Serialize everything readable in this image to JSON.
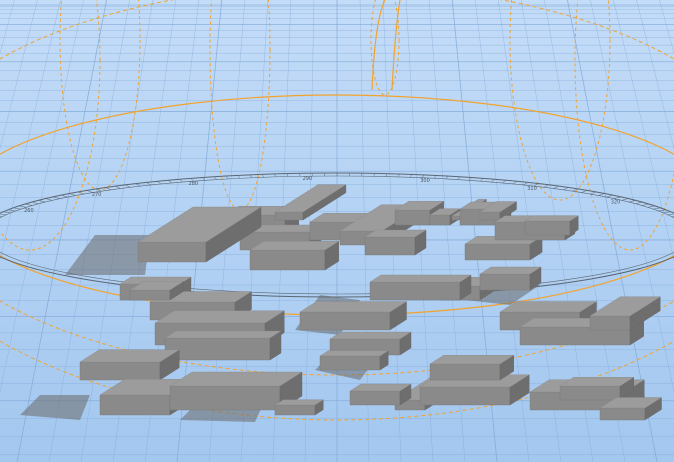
{
  "view": {
    "mode": "3d-city-massing",
    "colors": {
      "sky_top": "#bcd8f7",
      "sky_bottom": "#a4c8f0",
      "ground": "#a9ccf2",
      "grid_line": "#7fa7d6",
      "sun_path": "#f2a32e",
      "building_top": "#9c9c9c",
      "building_left": "#8a8a8a",
      "building_right": "#6e6e6e",
      "shadow": "#6a6a6a"
    }
  },
  "sun_path": {
    "visible": true,
    "compass_ring": true
  },
  "compass_labels": [
    "260",
    "270",
    "280",
    "290",
    "300",
    "310",
    "320"
  ]
}
